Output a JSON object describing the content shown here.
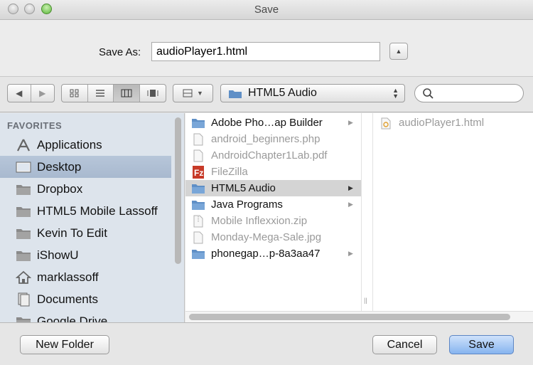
{
  "window": {
    "title": "Save"
  },
  "save_as": {
    "label": "Save As:",
    "value": "audioPlayer1.html"
  },
  "toolbar": {
    "path_label": "HTML5 Audio",
    "search_placeholder": ""
  },
  "sidebar": {
    "heading": "FAVORITES",
    "items": [
      {
        "label": "Applications",
        "icon": "applications-icon"
      },
      {
        "label": "Desktop",
        "icon": "desktop-icon",
        "selected": true
      },
      {
        "label": "Dropbox",
        "icon": "folder-icon"
      },
      {
        "label": "HTML5 Mobile Lassoff",
        "icon": "folder-icon"
      },
      {
        "label": "Kevin To Edit",
        "icon": "folder-icon"
      },
      {
        "label": "iShowU",
        "icon": "folder-icon"
      },
      {
        "label": "marklassoff",
        "icon": "home-icon"
      },
      {
        "label": "Documents",
        "icon": "documents-icon"
      },
      {
        "label": "Google Drive",
        "icon": "folder-icon"
      }
    ]
  },
  "column1": {
    "items": [
      {
        "label": "Adobe Pho…ap Builder",
        "type": "folder"
      },
      {
        "label": "android_beginners.php",
        "type": "file"
      },
      {
        "label": "AndroidChapter1Lab.pdf",
        "type": "file"
      },
      {
        "label": "FileZilla",
        "type": "app"
      },
      {
        "label": "HTML5 Audio",
        "type": "folder",
        "selected": true
      },
      {
        "label": "Java Programs",
        "type": "folder"
      },
      {
        "label": "Mobile Inflexxion.zip",
        "type": "file"
      },
      {
        "label": "Monday-Mega-Sale.jpg",
        "type": "file"
      },
      {
        "label": "phonegap…p-8a3aa47",
        "type": "folder"
      }
    ]
  },
  "column2": {
    "items": [
      {
        "label": "audioPlayer1.html",
        "type": "file"
      }
    ]
  },
  "buttons": {
    "new_folder": "New Folder",
    "cancel": "Cancel",
    "save": "Save"
  },
  "colors": {
    "sidebar_bg": "#dde4ec",
    "sidebar_selected": "#a8b9cf",
    "save_button": "#86b4ef",
    "folder": "#5f8fc6"
  }
}
